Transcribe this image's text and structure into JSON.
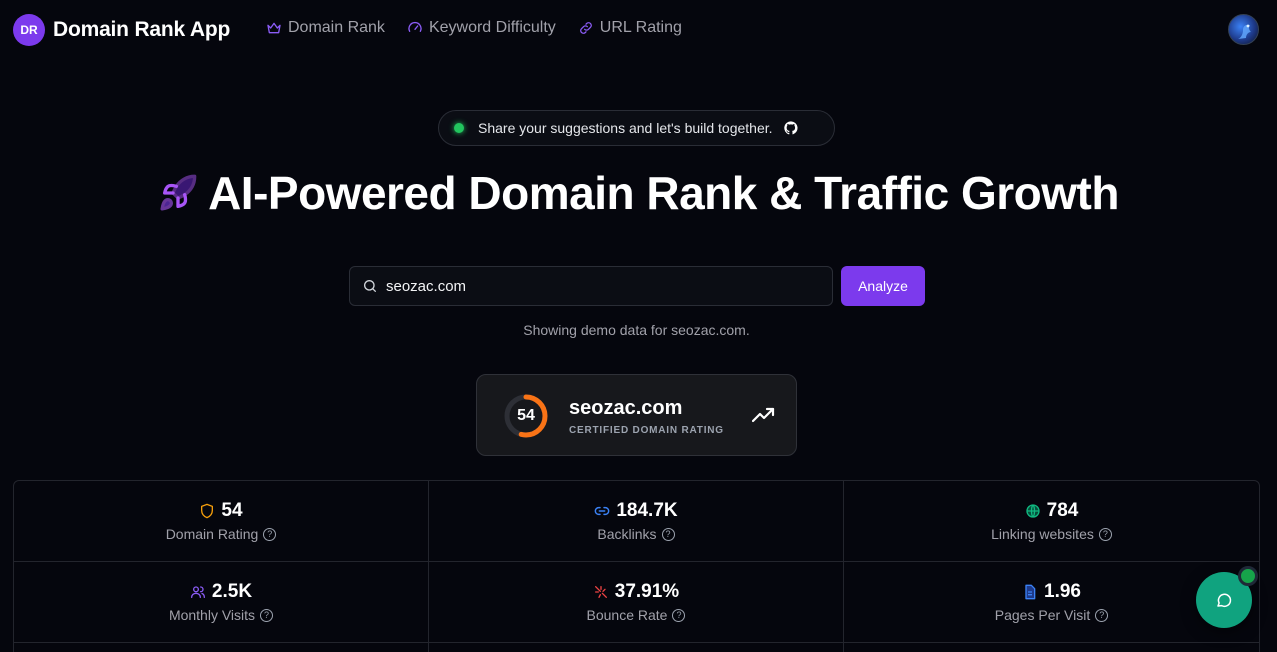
{
  "header": {
    "logo_initials": "DR",
    "app_title": "Domain Rank App",
    "nav": [
      {
        "label": "Domain Rank",
        "icon": "crown-icon"
      },
      {
        "label": "Keyword Difficulty",
        "icon": "gauge-icon"
      },
      {
        "label": "URL Rating",
        "icon": "link-icon"
      }
    ]
  },
  "announcement": {
    "text": "Share your suggestions and let's build together.",
    "icon": "github-icon"
  },
  "hero": {
    "title": "AI-Powered Domain Rank & Traffic Growth",
    "icon": "rocket-icon"
  },
  "search": {
    "value": "seozac.com",
    "button_label": "Analyze",
    "note": "Showing demo data for seozac.com."
  },
  "domain_card": {
    "score": "54",
    "score_fraction": 0.54,
    "domain": "seozac.com",
    "subtitle": "CERTIFIED DOMAIN RATING"
  },
  "metrics": [
    {
      "value": "54",
      "label": "Domain Rating",
      "icon": "shield-icon",
      "color": "#f59e0b"
    },
    {
      "value": "184.7K",
      "label": "Backlinks",
      "icon": "link-icon",
      "color": "#3b82f6"
    },
    {
      "value": "784",
      "label": "Linking websites",
      "icon": "globe-icon",
      "color": "#10b981"
    },
    {
      "value": "2.5K",
      "label": "Monthly Visits",
      "icon": "users-icon",
      "color": "#8b5cf6"
    },
    {
      "value": "37.91%",
      "label": "Bounce Rate",
      "icon": "bounce-icon",
      "color": "#ef4444"
    },
    {
      "value": "1.96",
      "label": "Pages Per Visit",
      "icon": "document-icon",
      "color": "#3b82f6"
    }
  ],
  "colors": {
    "accent": "#7c3aed",
    "background": "#05060d",
    "chat": "#10a37f"
  }
}
